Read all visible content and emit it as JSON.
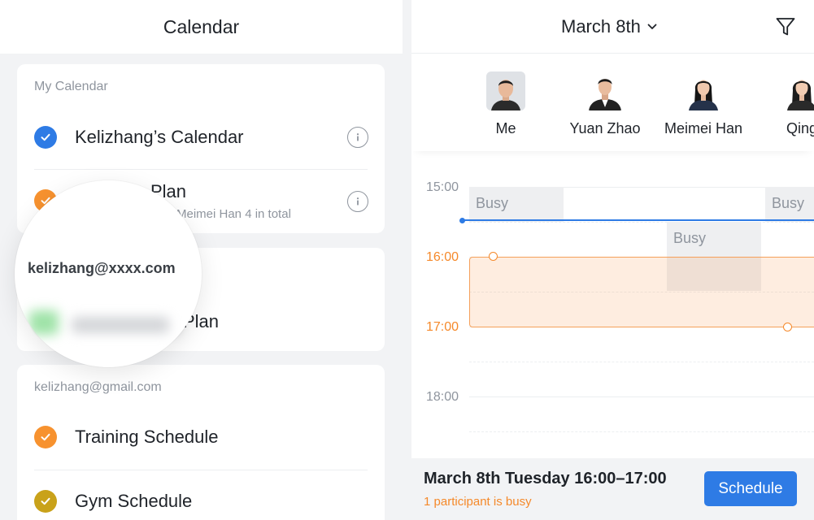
{
  "left": {
    "title": "Calendar",
    "my_calendar": {
      "section_label": "My Calendar",
      "items": [
        {
          "label": "Kelizhang’s Calendar",
          "color": "#2e7be5"
        },
        {
          "label_visible": "Plan",
          "sub_visible": "Meimei Han 4 in total",
          "color": "#f7922f"
        }
      ]
    },
    "account_card": {
      "item_label_visible": "Plan",
      "color": "#5cd068"
    },
    "gmail": {
      "section_label": "kelizhang@gmail.com",
      "items": [
        {
          "label": "Training Schedule",
          "color": "#f7922f"
        },
        {
          "label": "Gym Schedule",
          "color": "#c9a21a"
        }
      ]
    },
    "magnifier": {
      "email": "kelizhang@xxxx.com"
    }
  },
  "right": {
    "date_title": "March 8th",
    "people": [
      {
        "name": "Me"
      },
      {
        "name": "Yuan Zhao"
      },
      {
        "name": "Meimei Han"
      },
      {
        "name": "Qing"
      }
    ],
    "hours": [
      "15:00",
      "16:00",
      "17:00",
      "18:00"
    ],
    "busy_label": "Busy",
    "footer": {
      "title": "March 8th Tuesday  16:00–17:00",
      "subtitle": "1 participant is busy",
      "button": "Schedule"
    },
    "colors": {
      "accent_blue": "#2e7be5",
      "event_orange": "#f5892a"
    }
  }
}
